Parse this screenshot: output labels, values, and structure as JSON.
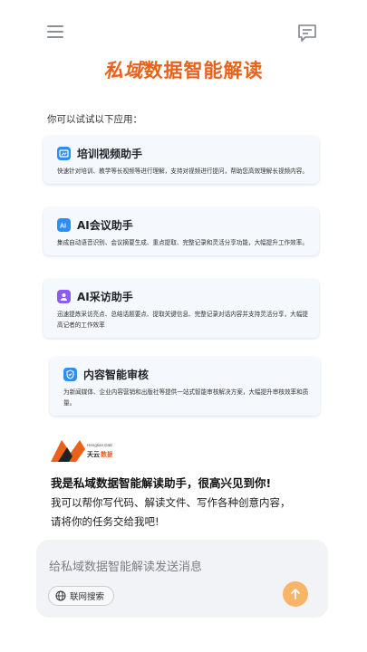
{
  "header": {
    "menu_icon": "hamburger-icon",
    "chat_icon": "message-icon",
    "title_brand": "私域",
    "title_rest": "数据智能解读",
    "accent_color": "#e8621b"
  },
  "intro": "你可以试试以下应用：",
  "apps": [
    {
      "title": "培训视频助手",
      "desc": "快速针对培训、教学等长视频等进行理解，支持对视频进行提问，帮助您高效理解长视频内容。",
      "icon": "video-icon",
      "icon_color": "#2f8ef5"
    },
    {
      "title": "AI会议助手",
      "desc": "集成自动语音识别、会议摘要生成、重点提取、完整记录和灵活分享功能，大幅提升工作效率。",
      "icon": "ai-meeting-icon",
      "icon_color": "#2f8ef5"
    },
    {
      "title": "AI采访助手",
      "desc": "迅速提炼采访亮点、总结话题要点、提取关键信息、完整记录对话内容并支持灵活分享，大幅提高记者的工作效率",
      "icon": "interview-icon",
      "icon_color": "#8a5cf0"
    },
    {
      "title": "内容智能审核",
      "desc": "为新闻媒体、企业内容营销和出版社等提供一站式智能审核解决方案，大幅提升审核效率和质量。",
      "icon": "shield-icon",
      "icon_color": "#2f8ef5"
    }
  ],
  "logo": {
    "name": "天云数据",
    "tagline": "Hengtian Data"
  },
  "greeting": {
    "title": "我是私域数据智能解读助手，很高兴见到你!",
    "line1": "我可以帮你写代码、解读文件、写作各种创意内容，",
    "line2": "请将你的任务交给我吧!"
  },
  "composer": {
    "placeholder": "给私域数据智能解读发送消息",
    "web_search_label": "联网搜索",
    "send_icon": "arrow-up-icon",
    "send_color": "#f8b467"
  }
}
